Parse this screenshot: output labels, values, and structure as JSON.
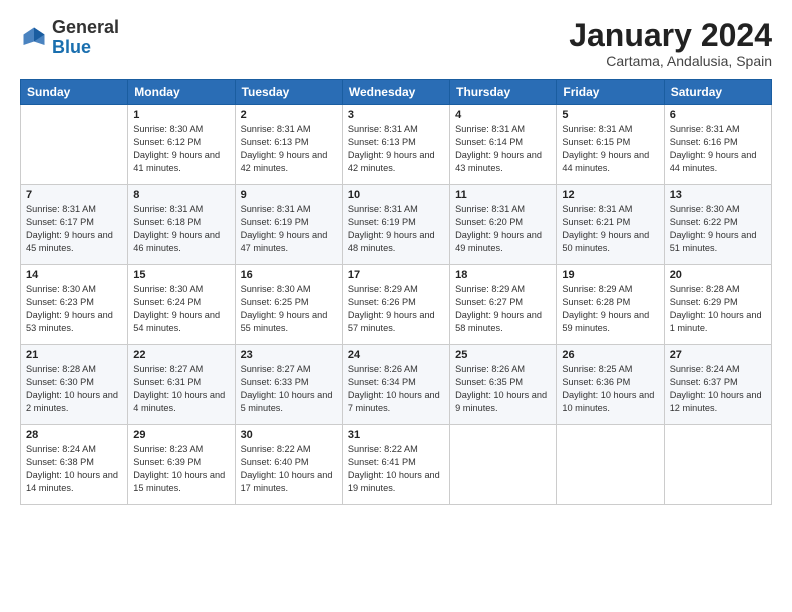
{
  "header": {
    "logo": {
      "general": "General",
      "blue": "Blue"
    },
    "title": "January 2024",
    "subtitle": "Cartama, Andalusia, Spain"
  },
  "weekdays": [
    "Sunday",
    "Monday",
    "Tuesday",
    "Wednesday",
    "Thursday",
    "Friday",
    "Saturday"
  ],
  "weeks": [
    [
      {
        "day": null,
        "sunrise": null,
        "sunset": null,
        "daylight": null
      },
      {
        "day": "1",
        "sunrise": "8:30 AM",
        "sunset": "6:12 PM",
        "daylight": "9 hours and 41 minutes."
      },
      {
        "day": "2",
        "sunrise": "8:31 AM",
        "sunset": "6:13 PM",
        "daylight": "9 hours and 42 minutes."
      },
      {
        "day": "3",
        "sunrise": "8:31 AM",
        "sunset": "6:13 PM",
        "daylight": "9 hours and 42 minutes."
      },
      {
        "day": "4",
        "sunrise": "8:31 AM",
        "sunset": "6:14 PM",
        "daylight": "9 hours and 43 minutes."
      },
      {
        "day": "5",
        "sunrise": "8:31 AM",
        "sunset": "6:15 PM",
        "daylight": "9 hours and 44 minutes."
      },
      {
        "day": "6",
        "sunrise": "8:31 AM",
        "sunset": "6:16 PM",
        "daylight": "9 hours and 44 minutes."
      }
    ],
    [
      {
        "day": "7",
        "sunrise": "8:31 AM",
        "sunset": "6:17 PM",
        "daylight": "9 hours and 45 minutes."
      },
      {
        "day": "8",
        "sunrise": "8:31 AM",
        "sunset": "6:18 PM",
        "daylight": "9 hours and 46 minutes."
      },
      {
        "day": "9",
        "sunrise": "8:31 AM",
        "sunset": "6:19 PM",
        "daylight": "9 hours and 47 minutes."
      },
      {
        "day": "10",
        "sunrise": "8:31 AM",
        "sunset": "6:19 PM",
        "daylight": "9 hours and 48 minutes."
      },
      {
        "day": "11",
        "sunrise": "8:31 AM",
        "sunset": "6:20 PM",
        "daylight": "9 hours and 49 minutes."
      },
      {
        "day": "12",
        "sunrise": "8:31 AM",
        "sunset": "6:21 PM",
        "daylight": "9 hours and 50 minutes."
      },
      {
        "day": "13",
        "sunrise": "8:30 AM",
        "sunset": "6:22 PM",
        "daylight": "9 hours and 51 minutes."
      }
    ],
    [
      {
        "day": "14",
        "sunrise": "8:30 AM",
        "sunset": "6:23 PM",
        "daylight": "9 hours and 53 minutes."
      },
      {
        "day": "15",
        "sunrise": "8:30 AM",
        "sunset": "6:24 PM",
        "daylight": "9 hours and 54 minutes."
      },
      {
        "day": "16",
        "sunrise": "8:30 AM",
        "sunset": "6:25 PM",
        "daylight": "9 hours and 55 minutes."
      },
      {
        "day": "17",
        "sunrise": "8:29 AM",
        "sunset": "6:26 PM",
        "daylight": "9 hours and 57 minutes."
      },
      {
        "day": "18",
        "sunrise": "8:29 AM",
        "sunset": "6:27 PM",
        "daylight": "9 hours and 58 minutes."
      },
      {
        "day": "19",
        "sunrise": "8:29 AM",
        "sunset": "6:28 PM",
        "daylight": "9 hours and 59 minutes."
      },
      {
        "day": "20",
        "sunrise": "8:28 AM",
        "sunset": "6:29 PM",
        "daylight": "10 hours and 1 minute."
      }
    ],
    [
      {
        "day": "21",
        "sunrise": "8:28 AM",
        "sunset": "6:30 PM",
        "daylight": "10 hours and 2 minutes."
      },
      {
        "day": "22",
        "sunrise": "8:27 AM",
        "sunset": "6:31 PM",
        "daylight": "10 hours and 4 minutes."
      },
      {
        "day": "23",
        "sunrise": "8:27 AM",
        "sunset": "6:33 PM",
        "daylight": "10 hours and 5 minutes."
      },
      {
        "day": "24",
        "sunrise": "8:26 AM",
        "sunset": "6:34 PM",
        "daylight": "10 hours and 7 minutes."
      },
      {
        "day": "25",
        "sunrise": "8:26 AM",
        "sunset": "6:35 PM",
        "daylight": "10 hours and 9 minutes."
      },
      {
        "day": "26",
        "sunrise": "8:25 AM",
        "sunset": "6:36 PM",
        "daylight": "10 hours and 10 minutes."
      },
      {
        "day": "27",
        "sunrise": "8:24 AM",
        "sunset": "6:37 PM",
        "daylight": "10 hours and 12 minutes."
      }
    ],
    [
      {
        "day": "28",
        "sunrise": "8:24 AM",
        "sunset": "6:38 PM",
        "daylight": "10 hours and 14 minutes."
      },
      {
        "day": "29",
        "sunrise": "8:23 AM",
        "sunset": "6:39 PM",
        "daylight": "10 hours and 15 minutes."
      },
      {
        "day": "30",
        "sunrise": "8:22 AM",
        "sunset": "6:40 PM",
        "daylight": "10 hours and 17 minutes."
      },
      {
        "day": "31",
        "sunrise": "8:22 AM",
        "sunset": "6:41 PM",
        "daylight": "10 hours and 19 minutes."
      },
      {
        "day": null,
        "sunrise": null,
        "sunset": null,
        "daylight": null
      },
      {
        "day": null,
        "sunrise": null,
        "sunset": null,
        "daylight": null
      },
      {
        "day": null,
        "sunrise": null,
        "sunset": null,
        "daylight": null
      }
    ]
  ],
  "labels": {
    "sunrise": "Sunrise:",
    "sunset": "Sunset:",
    "daylight": "Daylight:"
  }
}
